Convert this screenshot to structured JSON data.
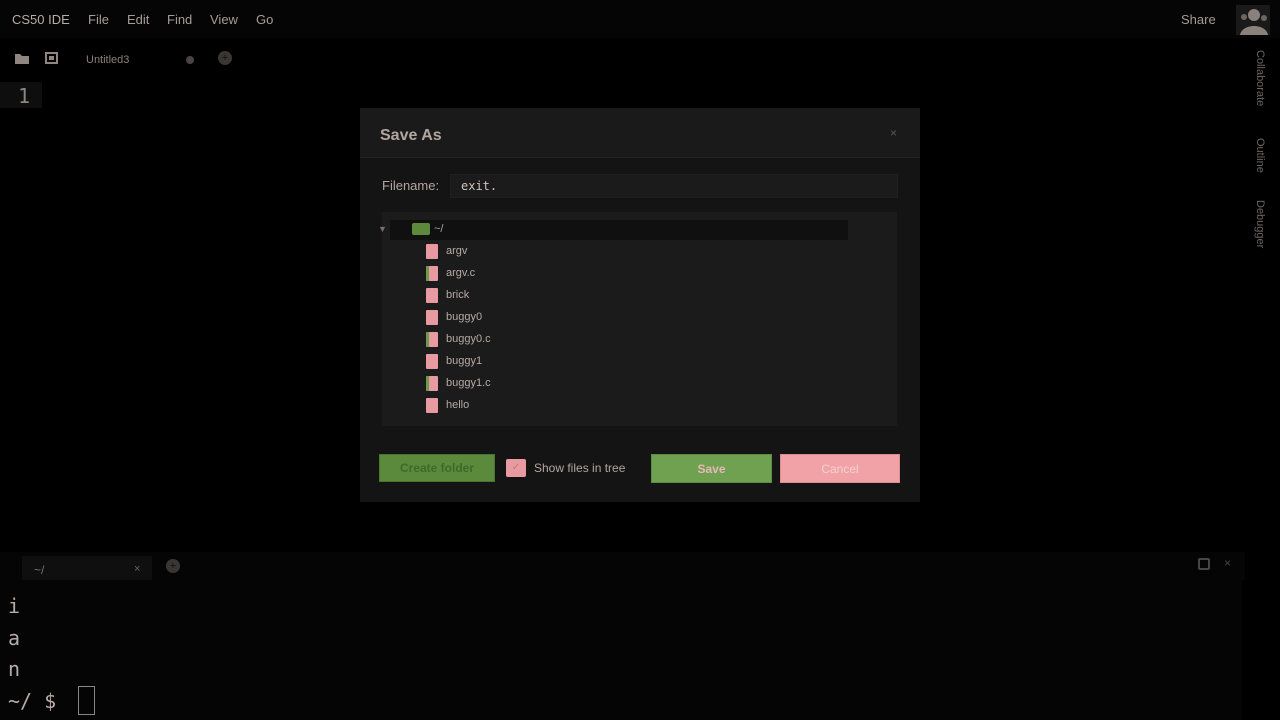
{
  "menubar": {
    "app_title": "CS50 IDE",
    "items": [
      "File",
      "Edit",
      "Find",
      "View",
      "Go"
    ],
    "share": "Share"
  },
  "tabs": [
    {
      "label": "Untitled3"
    }
  ],
  "tab_add": "+",
  "editor": {
    "line_number": "1"
  },
  "side_panels": [
    "Collaborate",
    "Outline",
    "Debugger"
  ],
  "dialog": {
    "title": "Save As",
    "close": "×",
    "filename_label": "Filename:",
    "filename_value": "exit.",
    "tree": {
      "caret": "▼",
      "root_label": "~/",
      "files": [
        {
          "name": "argv",
          "c_file": false
        },
        {
          "name": "argv.c",
          "c_file": true
        },
        {
          "name": "brick",
          "c_file": false
        },
        {
          "name": "buggy0",
          "c_file": false
        },
        {
          "name": "buggy0.c",
          "c_file": true
        },
        {
          "name": "buggy1",
          "c_file": false
        },
        {
          "name": "buggy1.c",
          "c_file": true
        },
        {
          "name": "hello",
          "c_file": false
        }
      ]
    },
    "create_folder_label": "Create folder",
    "show_files_check": "✓",
    "show_files_label": "Show files in tree",
    "save_label": "Save",
    "cancel_label": "Cancel"
  },
  "terminal": {
    "tab_label": "~/",
    "tab_close": "×",
    "add": "+",
    "close": "×",
    "lines": [
      "i",
      "a",
      "n",
      "~/ $"
    ]
  },
  "colors": {
    "file_icon": "#e79a9f",
    "folder_icon": "#5b8a3c",
    "save_button": "#6fa150",
    "cancel_button": "#f1a2a6",
    "create_folder_button": "#5c8a3d"
  }
}
